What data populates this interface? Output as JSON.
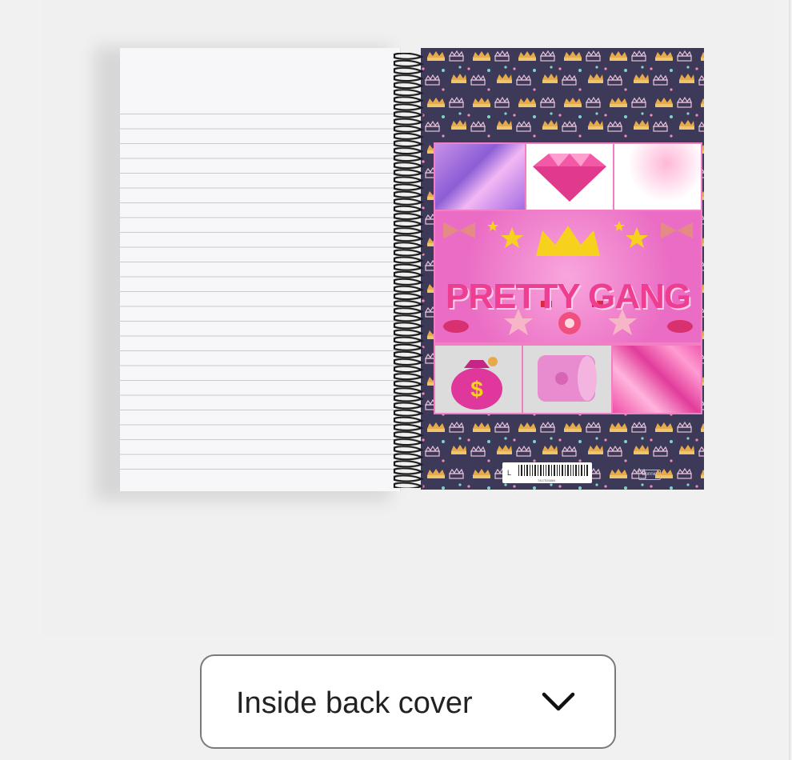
{
  "product": {
    "cover_title": "PRETTY GANG",
    "barcode_letter": "L",
    "barcode_number": "7417315884",
    "brand_tag": "Bonnie"
  },
  "view_selector": {
    "selected": "Inside back cover",
    "icon": "chevron-down-icon"
  },
  "colors": {
    "cover_pattern_bg": "#3d3a59",
    "accent_pink": "#ee3e91",
    "panel_pink": "#f27ec4",
    "crown_gold": "#e8a94a"
  }
}
